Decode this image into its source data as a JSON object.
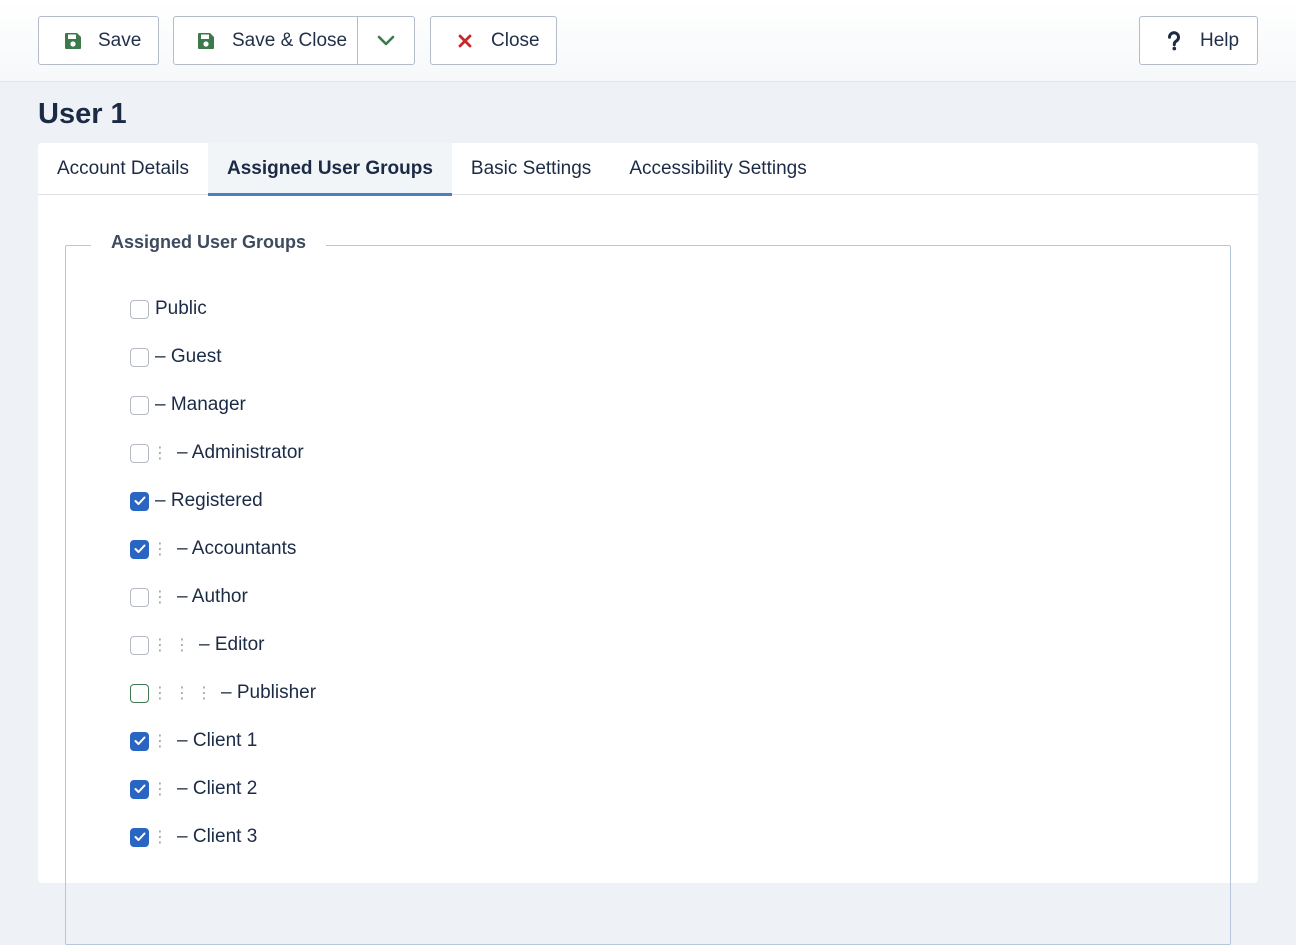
{
  "toolbar": {
    "save_label": "Save",
    "save_close_label": "Save & Close",
    "close_label": "Close",
    "help_label": "Help"
  },
  "page": {
    "title": "User 1"
  },
  "tabs": [
    {
      "label": "Account Details",
      "active": false
    },
    {
      "label": "Assigned User Groups",
      "active": true
    },
    {
      "label": "Basic Settings",
      "active": false
    },
    {
      "label": "Accessibility Settings",
      "active": false
    }
  ],
  "fieldset": {
    "legend": "Assigned User Groups",
    "groups": [
      {
        "label": "Public",
        "level": 0,
        "checked": false
      },
      {
        "label": "– Guest",
        "level": 1,
        "checked": false
      },
      {
        "label": "– Manager",
        "level": 1,
        "checked": false
      },
      {
        "label": "– Administrator",
        "level": 2,
        "checked": false
      },
      {
        "label": "– Registered",
        "level": 1,
        "checked": true
      },
      {
        "label": "– Accountants",
        "level": 2,
        "checked": true
      },
      {
        "label": "– Author",
        "level": 2,
        "checked": false
      },
      {
        "label": "– Editor",
        "level": 3,
        "checked": false
      },
      {
        "label": "– Publisher",
        "level": 4,
        "checked": false,
        "focused": true
      },
      {
        "label": "– Client 1",
        "level": 2,
        "checked": true
      },
      {
        "label": "– Client 2",
        "level": 2,
        "checked": true
      },
      {
        "label": "– Client 3",
        "level": 2,
        "checked": true
      }
    ]
  },
  "colors": {
    "accent": "#2a65c1",
    "save_icon": "#3d7a4b",
    "close_icon": "#c52a2a",
    "tab_indicator": "#4a7fc1"
  },
  "icons": {
    "save": "floppy-disk-icon",
    "dropdown": "chevron-down-icon",
    "close": "x-icon",
    "help": "question-mark-icon",
    "check": "checkmark-icon"
  }
}
